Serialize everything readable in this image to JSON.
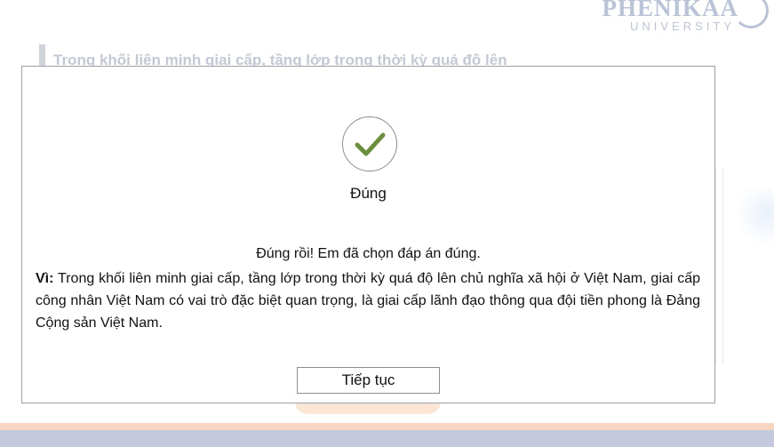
{
  "brand": {
    "name": "PHENIKAA",
    "subtitle": "UNIVERSITY"
  },
  "background": {
    "question_text": "Trong khối liên minh giai cấp, tầng lớp trong thời kỳ quá độ lên"
  },
  "dialog": {
    "result_title": "Đúng",
    "feedback": "Đúng rồi! Em đã chọn đáp án đúng.",
    "explanation_label": "Vì:",
    "explanation_text": " Trong khối liên minh giai cấp, tầng lớp trong thời kỳ quá độ lên chủ nghĩa xã hội ở Việt Nam, giai cấp công nhân Việt Nam có vai trò đặc biệt quan trọng, là giai cấp lãnh đạo thông qua đội tiền phong là Đảng Cộng sản Việt Nam.",
    "continue_label": "Tiếp tục",
    "icon": "check-icon"
  },
  "colors": {
    "check": "#6a8f3a",
    "logo": "#b9c4d8",
    "footer_peach": "#f8d6c2",
    "footer_lavender": "#c5c9de"
  }
}
